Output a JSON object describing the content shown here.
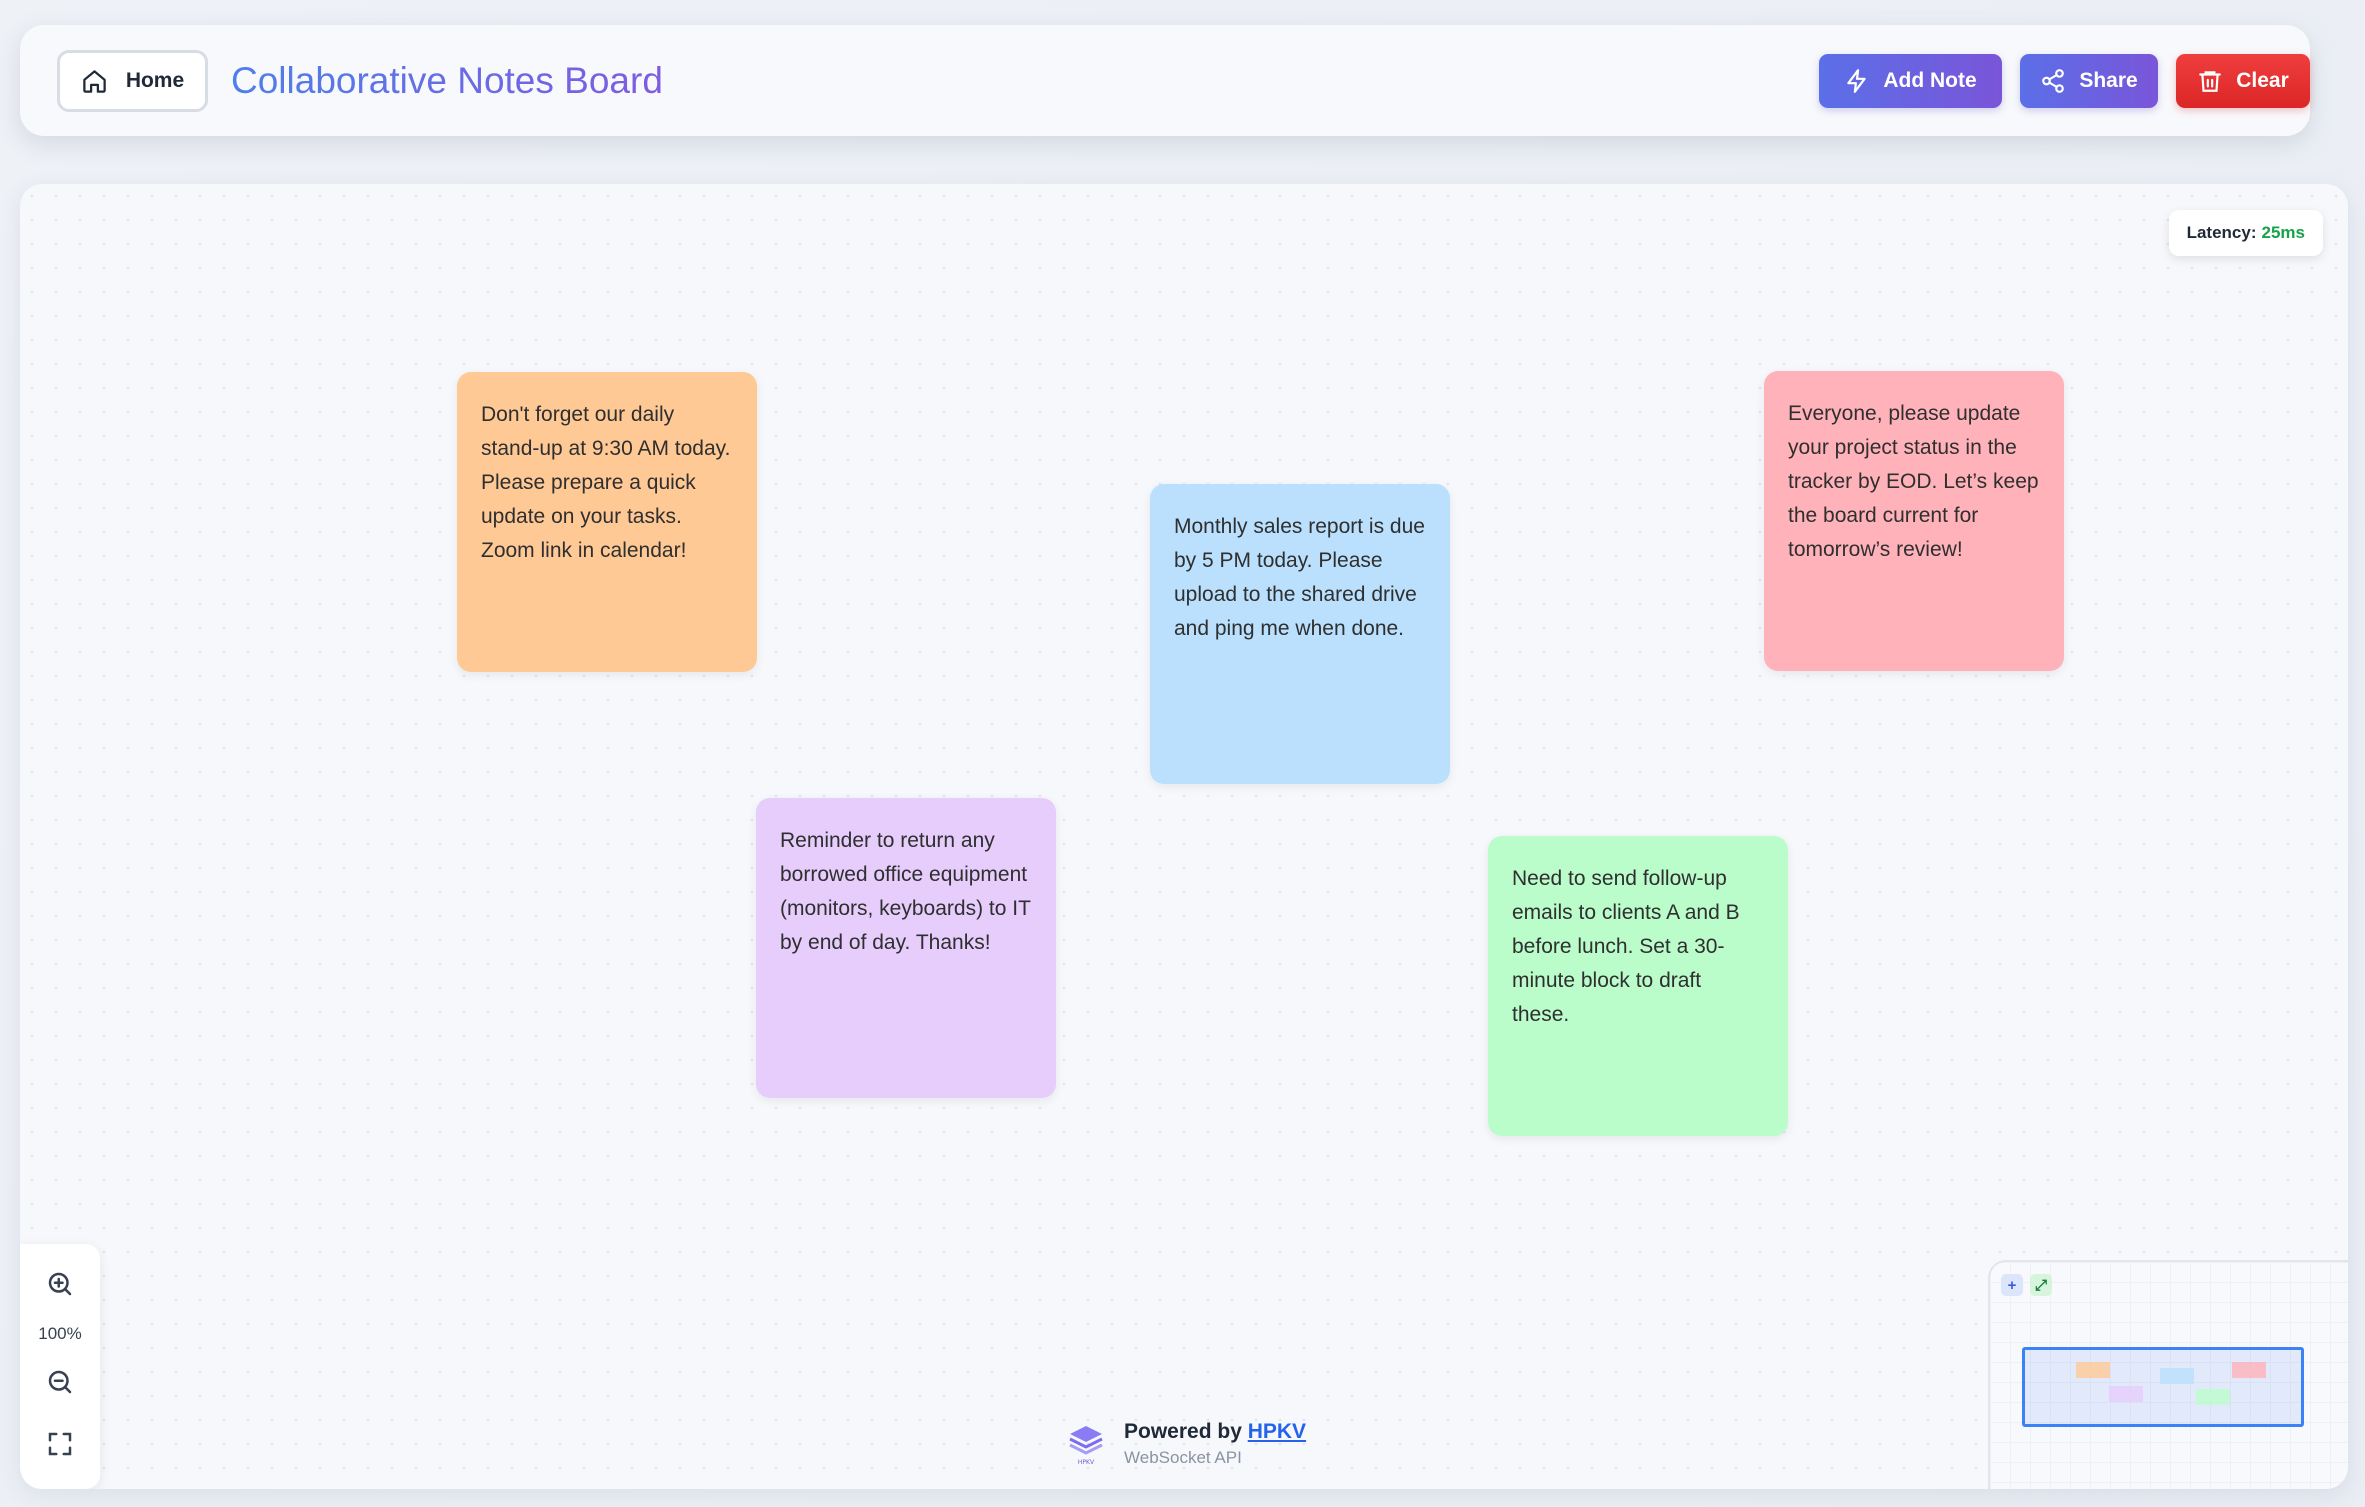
{
  "header": {
    "home_label": "Home",
    "title": "Collaborative Notes Board",
    "add_note_label": "Add Note",
    "share_label": "Share",
    "clear_label": "Clear"
  },
  "latency": {
    "label": "Latency:",
    "value": "25ms",
    "value_color": "#16a34a"
  },
  "notes": [
    {
      "text": "Don't forget our daily stand-up at 9:30 AM today. Please prepare a quick update on your tasks. Zoom link in calendar!",
      "color": "#ffc996"
    },
    {
      "text": "Monthly sales report is due by 5 PM today. Please upload to the shared drive and ping me when done.",
      "color": "#bae0fd"
    },
    {
      "text": "Everyone, please update your project status in the tracker by EOD. Let’s keep the board current for tomorrow’s review!",
      "color": "#ffb2ba"
    },
    {
      "text": "Reminder to return any borrowed office equipment (monitors, keyboards) to IT by end of day. Thanks!",
      "color": "#e6cdfc"
    },
    {
      "text": "Need to send follow-up emails to clients A and B before lunch. Set a 30-minute block to draft these.",
      "color": "#bbfccb"
    }
  ],
  "zoom": {
    "level": "100%",
    "zoom_in_icon": "zoom-in-icon",
    "zoom_out_icon": "zoom-out-icon",
    "fit_icon": "fullscreen-icon"
  },
  "footer": {
    "powered_prefix": "Powered by",
    "powered_link": "HPKV",
    "subtitle": "WebSocket API",
    "logo_text": "HPKV"
  },
  "minimap": {
    "plus_label": "+",
    "expand_label": "⤢"
  },
  "colors": {
    "accent_gradient_start": "#5b6fe8",
    "accent_gradient_end": "#7a55d9",
    "danger": "#dc2626"
  }
}
